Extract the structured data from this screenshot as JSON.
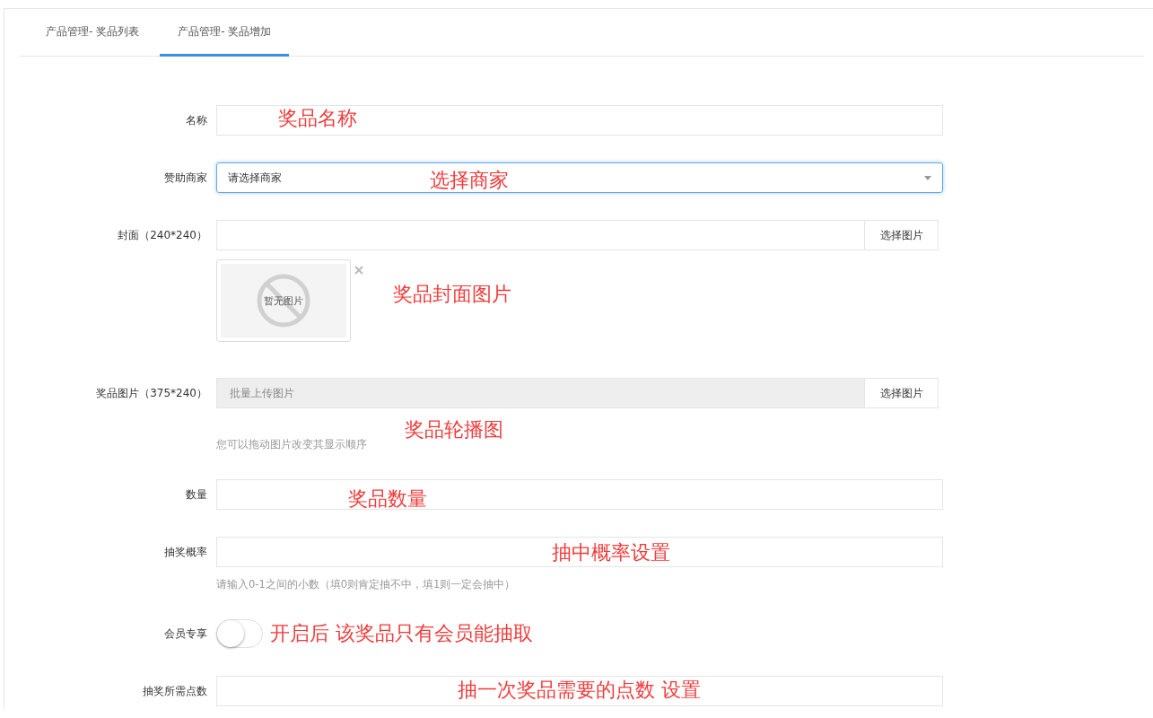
{
  "tabs": [
    {
      "label": "产品管理- 奖品列表",
      "selected": false
    },
    {
      "label": "产品管理- 奖品增加",
      "selected": true
    }
  ],
  "form": [
    {
      "kind": "text",
      "label": "名称",
      "note": "奖品名称"
    },
    {
      "kind": "select",
      "label": "赞助商家",
      "placeholder": "请选择商家",
      "focused": true,
      "note": "选择商家"
    },
    {
      "kind": "cover",
      "label": "封面（240*240）",
      "button": "选择图片",
      "preview": "暂无图片",
      "note": "奖品封面图片"
    },
    {
      "kind": "gallery",
      "label": "奖品图片（375*240）",
      "placeholder": "批量上传图片",
      "button": "选择图片",
      "hint": "您可以拖动图片改变其显示顺序",
      "note": "奖品轮播图"
    },
    {
      "kind": "text",
      "label": "数量",
      "note": "奖品数量"
    },
    {
      "kind": "text",
      "label": "抽奖概率",
      "hint": "请输入0-1之间的小数（填0则肯定抽不中，填1则一定会抽中）",
      "note": "抽中概率设置"
    },
    {
      "kind": "toggle",
      "label": "会员专享",
      "on": false,
      "note": "开启后  该奖品只有会员能抽取"
    },
    {
      "kind": "text",
      "label": "抽奖所需点数",
      "note": "抽一次奖品需要的点数  设置"
    }
  ]
}
